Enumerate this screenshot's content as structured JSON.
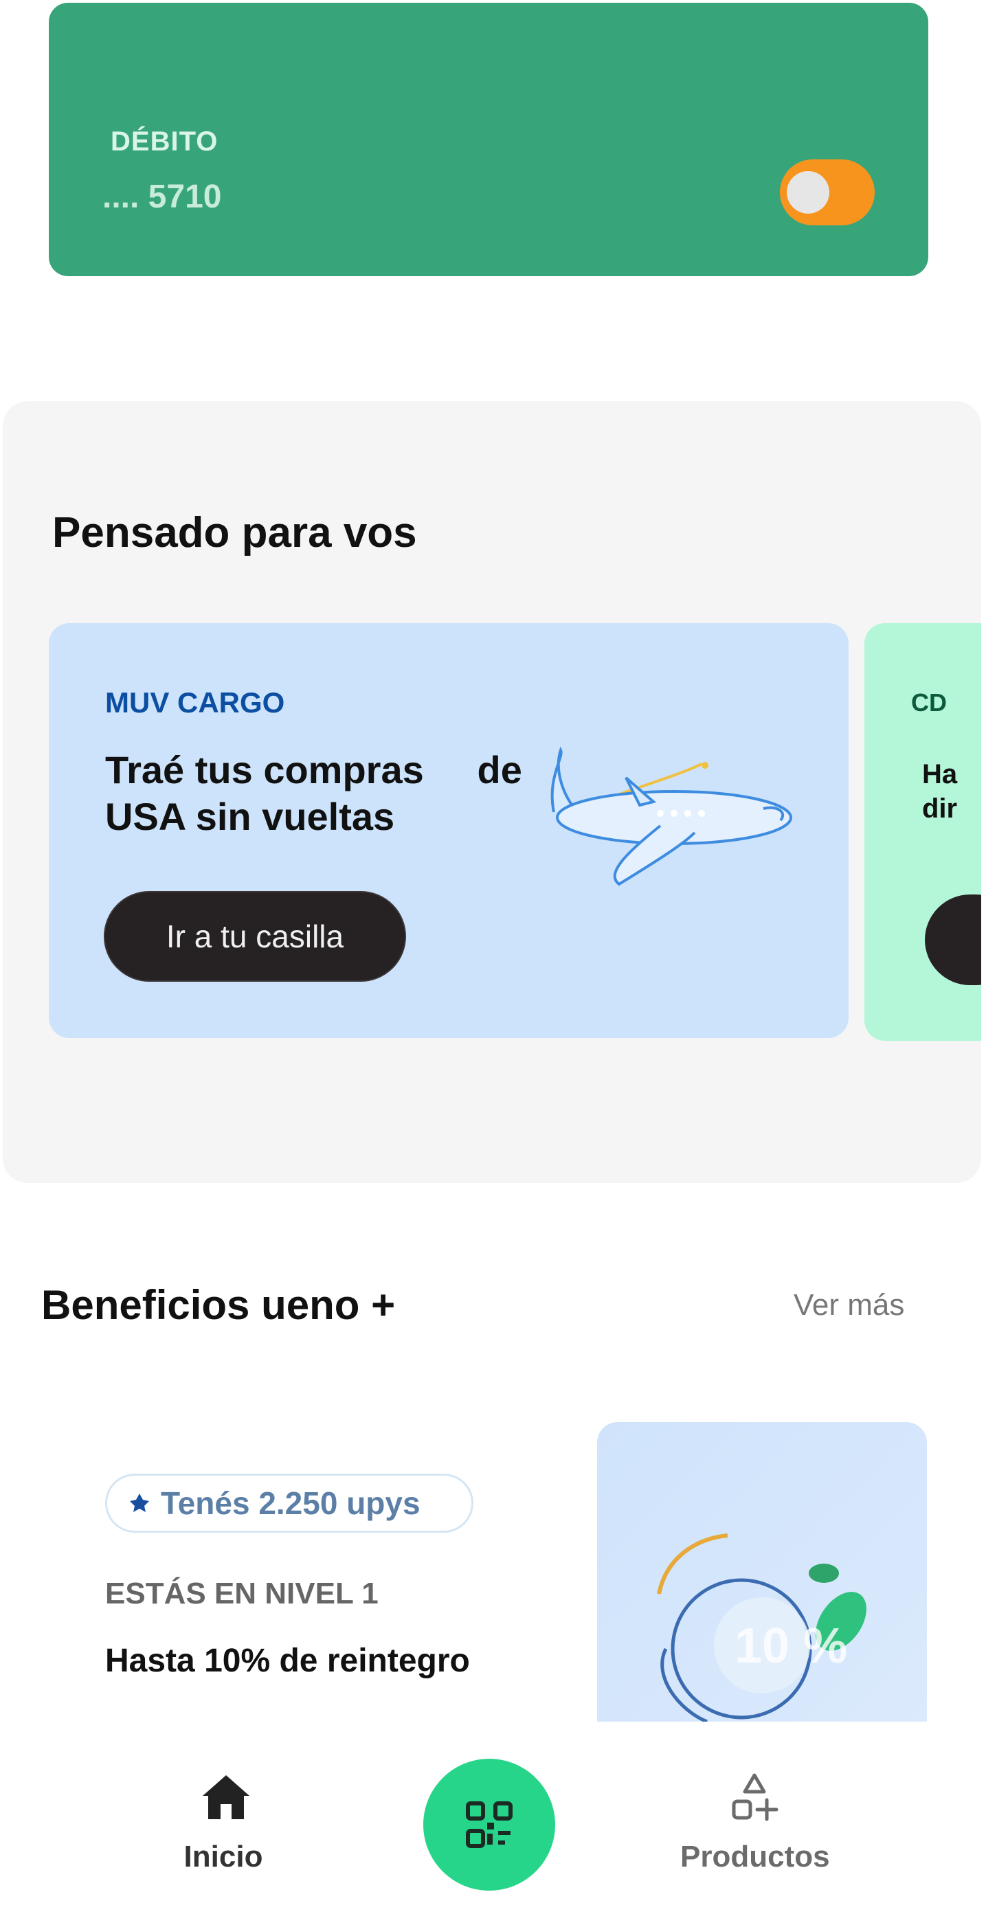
{
  "debit_card": {
    "type_label": "DÉBITO",
    "number": ".... 5710",
    "toggle_on": true,
    "color": "#38a47a",
    "toggle_color": "#f7941d"
  },
  "pensado": {
    "title": "Pensado para vos",
    "cards": [
      {
        "tag": "MUV CARGO",
        "headline": "Traé tus compras     de USA sin vueltas",
        "button_label": "Ir a tu casilla",
        "icon": "airplane-illustration"
      },
      {
        "tag": "CD",
        "headline": "Ha dir",
        "button_label": ""
      }
    ]
  },
  "beneficios": {
    "title": "Beneficios ueno +",
    "see_more": "Ver más",
    "upys_text": "Tenés 2.250 upys",
    "level": "ESTÁS EN NIVEL 1",
    "reintegro": "Hasta 10% de reintegro"
  },
  "nav": {
    "home_label": "Inicio",
    "products_label": "Productos",
    "qr_icon": "qr-scan-icon"
  }
}
